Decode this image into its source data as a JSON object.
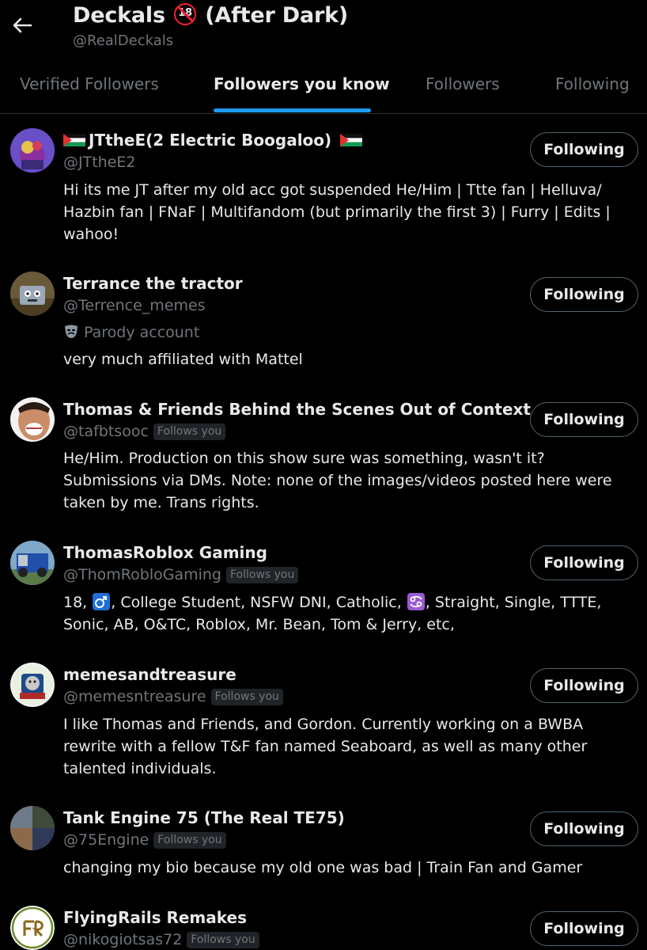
{
  "header": {
    "title_prefix": "Deckals",
    "age_badge": "18",
    "title_suffix": "(After Dark)",
    "handle": "@RealDeckals"
  },
  "tabs": [
    {
      "label": "Verified Followers",
      "active": false
    },
    {
      "label": "Followers you know",
      "active": true
    },
    {
      "label": "Followers",
      "active": false
    },
    {
      "label": "Following",
      "active": false
    }
  ],
  "accent_color": "#1d9bf0",
  "users": [
    {
      "name": "JTtheE(2 Electric Boogaloo)",
      "handle": "@JTtheE2",
      "follows_you": "",
      "parody": "",
      "bio": [
        "Hi its me JT after my old acc got suspended He/Him | Ttte fan | Helluva/",
        "Hazbin fan | FNaF | Multifandom (but primarily the first 3) | Furry | Edits |",
        "wahoo!"
      ],
      "button": "Following"
    },
    {
      "name": "Terrance the tractor",
      "handle": "@Terrence_memes",
      "follows_you": "",
      "parody": "Parody account",
      "bio": [
        "very much affiliated with Mattel"
      ],
      "button": "Following"
    },
    {
      "name": "Thomas & Friends Behind the Scenes Out of Context",
      "handle": "@tafbtsooc",
      "follows_you": "Follows you",
      "parody": "",
      "bio": [
        "He/Him. Production on this show sure was something, wasn't it?",
        "Submissions via DMs. Note: none of the images/videos posted here were",
        "taken by me. Trans rights."
      ],
      "button": "Following"
    },
    {
      "name": "ThomasRoblox Gaming",
      "handle": "@ThomRobloGaming",
      "follows_you": "Follows you",
      "parody": "",
      "bio_parts": {
        "line1_a": "18, ",
        "line1_b": ", College Student, NSFW DNI, Catholic, ",
        "line1_c": ", Straight, Single, TTTE,",
        "line2": "Sonic, AB, O&TC, Roblox, Mr. Bean, Tom & Jerry, etc,"
      },
      "button": "Following"
    },
    {
      "name": "memesandtreasure",
      "handle": "@memesntreasure",
      "follows_you": "Follows you",
      "parody": "",
      "bio": [
        "I like Thomas and Friends, and Gordon. Currently working on a BWBA",
        "rewrite with a fellow T&F fan named Seaboard, as well as many other",
        "talented individuals."
      ],
      "button": "Following"
    },
    {
      "name": "Tank Engine 75 (The Real TE75)",
      "handle": "@75Engine",
      "follows_you": "Follows you",
      "parody": "",
      "bio": [
        "changing my bio because my old one was bad | Train Fan and Gamer"
      ],
      "button": "Following"
    },
    {
      "name": "FlyingRails Remakes",
      "handle": "@nikogiotsas72",
      "follows_you": "Follows you",
      "parody": "",
      "bio": [],
      "button": "Following"
    }
  ]
}
